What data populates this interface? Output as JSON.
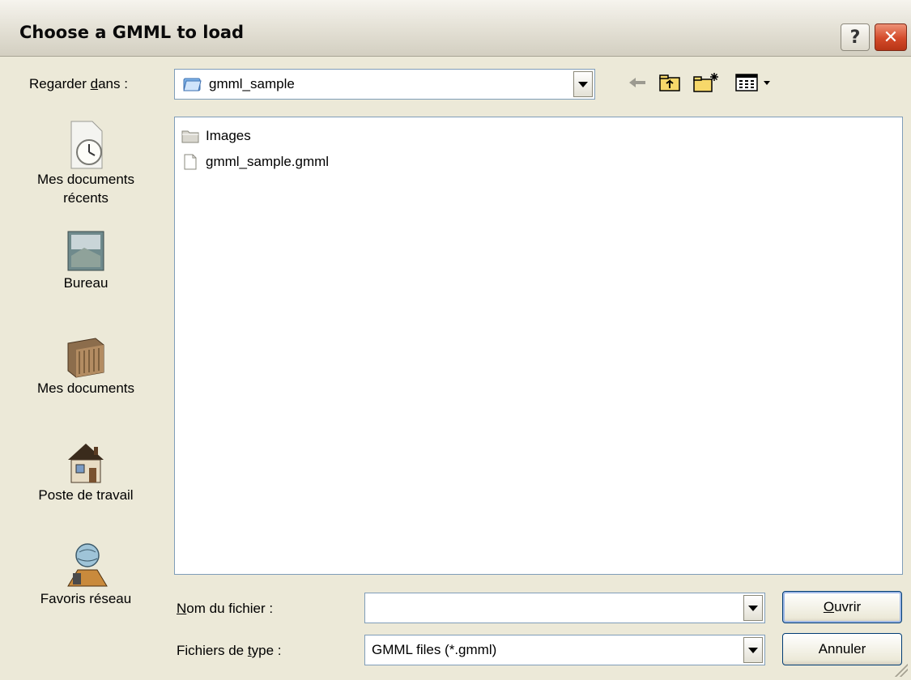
{
  "window": {
    "title": "Choose a GMML to load",
    "help_glyph": "?",
    "close_glyph": "✕"
  },
  "look_in": {
    "label_pre": "Regarder ",
    "label_underlined": "d",
    "label_post": "ans :",
    "value": "gmml_sample"
  },
  "places": [
    {
      "label_line1": "Mes documents",
      "label_line2": "récents",
      "icon": "recent-documents-icon"
    },
    {
      "label_line1": "Bureau",
      "label_line2": "",
      "icon": "desktop-icon"
    },
    {
      "label_line1": "Mes documents",
      "label_line2": "",
      "icon": "my-documents-icon"
    },
    {
      "label_line1": "Poste de travail",
      "label_line2": "",
      "icon": "my-computer-icon"
    },
    {
      "label_line1": "Favoris réseau",
      "label_line2": "",
      "icon": "network-places-icon"
    }
  ],
  "files": [
    {
      "name": "Images",
      "type": "folder"
    },
    {
      "name": "gmml_sample.gmml",
      "type": "file"
    }
  ],
  "filename": {
    "label_underlined": "N",
    "label_post": "om du fichier :",
    "value": ""
  },
  "filetype": {
    "label_pre": "Fichiers de ",
    "label_underlined": "t",
    "label_post": "ype :",
    "value": "GMML files (*.gmml)"
  },
  "buttons": {
    "open_underlined": "O",
    "open_post": "uvrir",
    "cancel": "Annuler"
  },
  "colors": {
    "dialog_bg": "#ece9d8",
    "border_blue": "#7f9db9",
    "close_red": "#d34a2a"
  }
}
